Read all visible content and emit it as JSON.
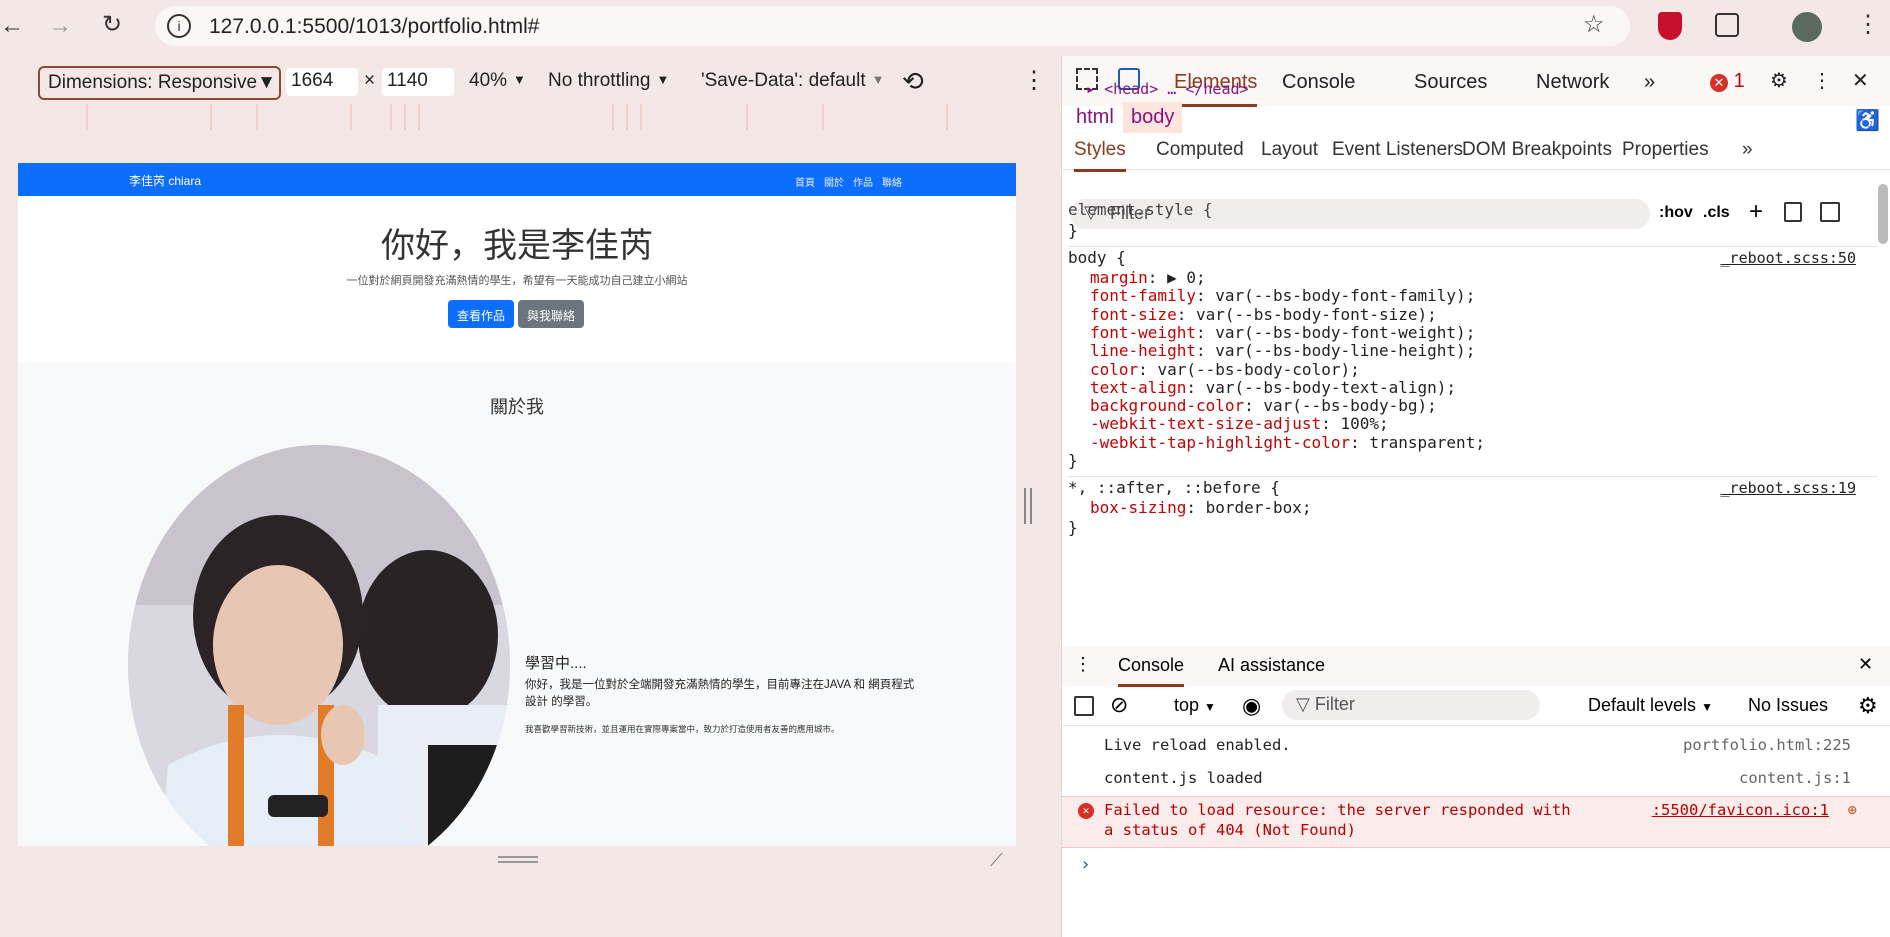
{
  "browser": {
    "url": "127.0.0.1:5500/1013/portfolio.html#"
  },
  "device_toolbar": {
    "dimensions_label": "Dimensions: Responsive",
    "width": "1664",
    "times": "×",
    "height": "1140",
    "zoom": "40%",
    "throttling": "No throttling",
    "save_data": "'Save-Data': default"
  },
  "site": {
    "brand": "李佳芮 chiara",
    "nav": [
      "首頁",
      "關於",
      "作品",
      "聯絡"
    ],
    "hero_title": "你好，我是李佳芮",
    "hero_sub": "一位對於網頁開發充滿熱情的學生，希望有一天能成功自己建立小網站",
    "btn_works": "查看作品",
    "btn_contact": "與我聯絡",
    "about_title": "關於我",
    "learning": "學習中....",
    "about_p1": "你好，我是一位對於全端開發充滿熱情的學生，目前專注在JAVA 和 網頁程式設計 的學習。",
    "about_p2": "我喜歡學習新技術，並且運用在實際專案當中，致力於打造使用者友善的應用城市。",
    "colors": {
      "navbar": "#0d6efd",
      "btn_primary": "#0d6efd",
      "btn_secondary": "#6c757d"
    }
  },
  "devtools": {
    "tabs": [
      "Elements",
      "Console",
      "Sources",
      "Network"
    ],
    "error_count": "1",
    "head_collapsed": "<head> … </head>",
    "breadcrumbs": [
      "html",
      "body"
    ],
    "style_tabs": [
      "Styles",
      "Computed",
      "Layout",
      "Event Listeners",
      "DOM Breakpoints",
      "Properties"
    ],
    "filter_placeholder": "Filter",
    "hov": ":hov",
    "cls": ".cls",
    "element_style_open": "element.style {",
    "close_brace": "}",
    "body_selector": "body {",
    "body_source": "_reboot.scss:50",
    "body_rules": [
      {
        "prop": "margin",
        "val": "▶ 0;"
      },
      {
        "prop": "font-family",
        "val": "var(--bs-body-font-family);"
      },
      {
        "prop": "font-size",
        "val": "var(--bs-body-font-size);"
      },
      {
        "prop": "font-weight",
        "val": "var(--bs-body-font-weight);"
      },
      {
        "prop": "line-height",
        "val": "var(--bs-body-line-height);"
      },
      {
        "prop": "color",
        "val": "var(--bs-body-color);"
      },
      {
        "prop": "text-align",
        "val": "var(--bs-body-text-align);"
      },
      {
        "prop": "background-color",
        "val": "var(--bs-body-bg);"
      },
      {
        "prop": "-webkit-text-size-adjust",
        "val": "100%;"
      },
      {
        "prop": "-webkit-tap-highlight-color",
        "val": "transparent;"
      }
    ],
    "universal_selector": "*, ::after, ::before {",
    "universal_source": "_reboot.scss:19",
    "universal_rule": {
      "prop": "box-sizing",
      "val": "border-box;"
    },
    "drawer_tabs": [
      "Console",
      "AI assistance"
    ],
    "console_context": "top",
    "console_filter": "Filter",
    "levels": "Default levels",
    "issues": "No Issues",
    "messages": [
      {
        "text": "Live reload enabled.",
        "source": "portfolio.html:225"
      },
      {
        "text": "content.js loaded",
        "source": "content.js:1"
      }
    ],
    "error": {
      "line1": "Failed to load resource: the server responded with",
      "line2": "a status of 404 (Not Found)",
      "source": ":5500/favicon.ico:1"
    },
    "prompt": "›"
  }
}
